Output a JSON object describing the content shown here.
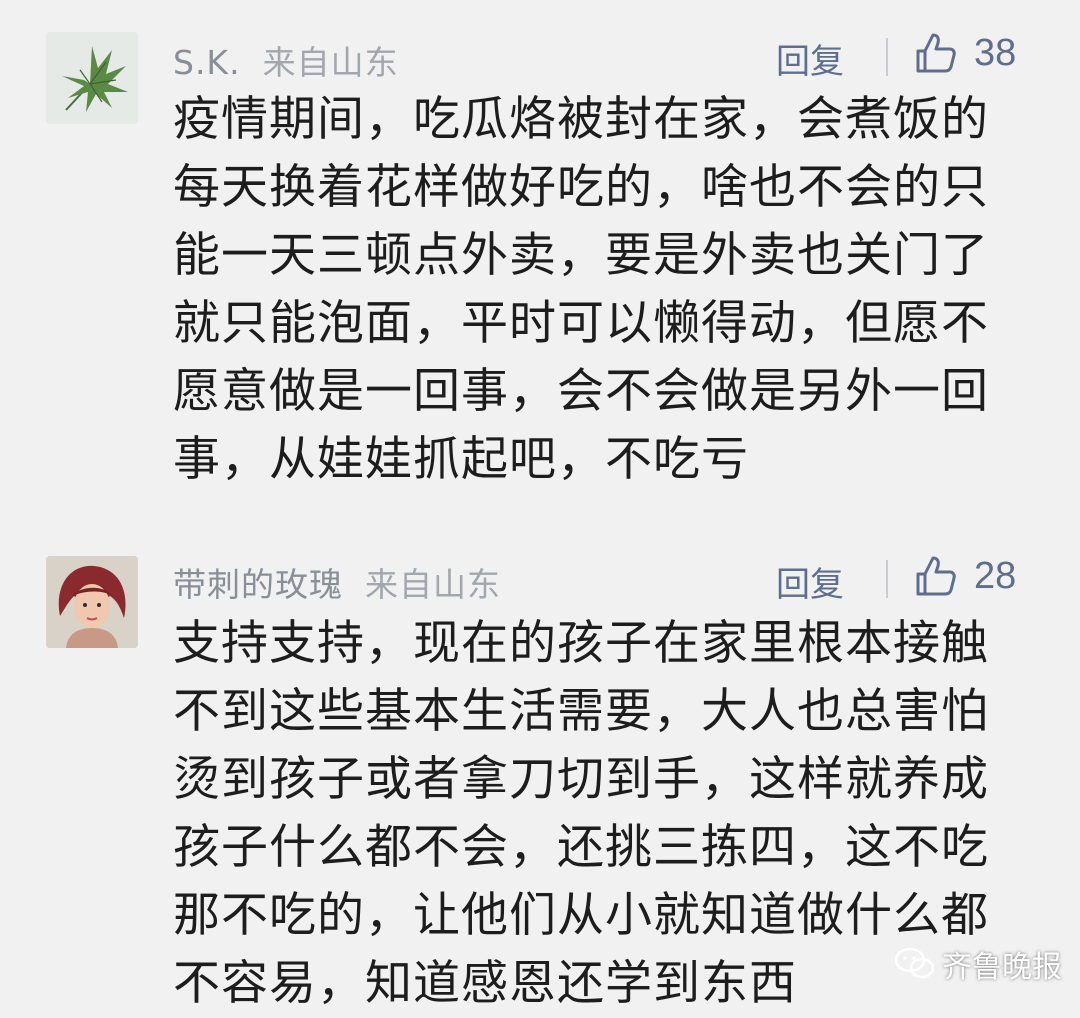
{
  "comments": [
    {
      "nickname": "S.K.",
      "location": "来自山东",
      "reply_label": "回复",
      "likes": "38",
      "text": "疫情期间，吃瓜烙被封在家，会煮饭的\n每天换着花样做好吃的，啥也不会的只\n能一天三顿点外卖，要是外卖也关门了\n就只能泡面，平时可以懒得动，但愿不\n愿意做是一回事，会不会做是另外一回\n事，从娃娃抓起吧，不吃亏"
    },
    {
      "nickname": "带刺的玫瑰",
      "location": "来自山东",
      "reply_label": "回复",
      "likes": "28",
      "text": "支持支持，现在的孩子在家里根本接触\n不到这些基本生活需要，大人也总害怕\n烫到孩子或者拿刀切到手，这样就养成\n孩子什么都不会，还挑三拣四，这不吃\n那不吃的，让他们从小就知道做什么都\n不容易，知道感恩还学到东西"
    }
  ],
  "watermark": {
    "text": "齐鲁晚报",
    "icon": "wechat-icon"
  },
  "icons": {
    "like": "thumbs-up-icon",
    "avatar1": "leaf-avatar",
    "avatar2": "woman-avatar"
  },
  "colors": {
    "background": "#f1f1f1",
    "meta": "#8a8f97",
    "accent": "#5f6e8c",
    "text": "#1d1d1d"
  }
}
